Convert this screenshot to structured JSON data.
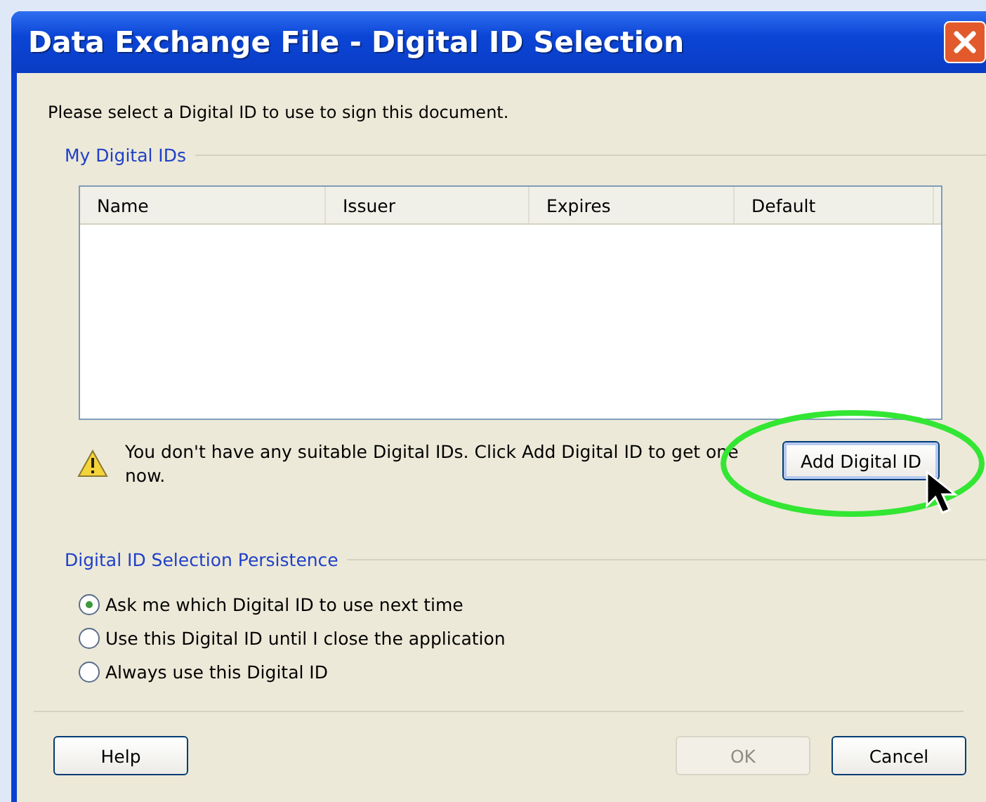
{
  "window": {
    "title": "Data Exchange File - Digital ID Selection"
  },
  "instruction": "Please select a Digital ID to use to sign this document.",
  "my_ids": {
    "label": "My Digital IDs",
    "columns": [
      "Name",
      "Issuer",
      "Expires",
      "Default"
    ],
    "warning": "You don't have any suitable Digital IDs. Click Add Digital ID to get one now.",
    "add_button": "Add Digital ID"
  },
  "persistence": {
    "label": "Digital ID Selection Persistence",
    "options": [
      {
        "label": "Ask me which Digital ID to use next time",
        "selected": true
      },
      {
        "label": "Use this Digital ID until I close the application",
        "selected": false
      },
      {
        "label": "Always use this Digital ID",
        "selected": false
      }
    ]
  },
  "buttons": [
    {
      "label": "Help",
      "kind": "left",
      "disabled": false
    },
    {
      "label": "OK",
      "kind": "right",
      "disabled": true
    },
    {
      "label": "Cancel",
      "kind": "right",
      "disabled": false
    }
  ]
}
